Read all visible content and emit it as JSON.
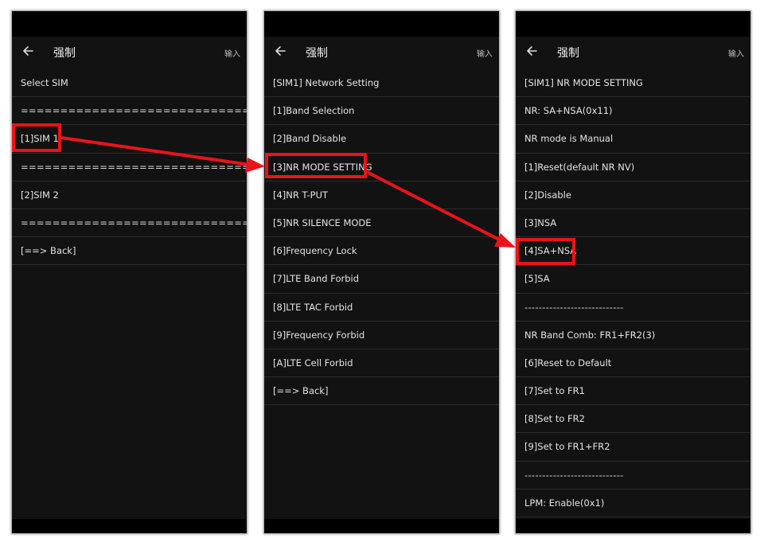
{
  "panels": [
    {
      "title": "强制",
      "action_label": "输入",
      "items": [
        "Select SIM",
        "=============================",
        "[1]SIM 1",
        "=============================",
        "[2]SIM 2",
        "=============================",
        "[==> Back]"
      ]
    },
    {
      "title": "强制",
      "action_label": "输入",
      "items": [
        "[SIM1] Network Setting",
        "[1]Band Selection",
        "[2]Band Disable",
        "[3]NR MODE SETTING",
        "[4]NR T-PUT",
        "[5]NR SILENCE MODE",
        "[6]Frequency Lock",
        "[7]LTE Band Forbid",
        "[8]LTE TAC Forbid",
        "[9]Frequency Forbid",
        "[A]LTE Cell Forbid",
        "[==> Back]"
      ]
    },
    {
      "title": "强制",
      "action_label": "输入",
      "items": [
        "[SIM1] NR MODE SETTING",
        "NR: SA+NSA(0x11)",
        "NR mode is Manual",
        "[1]Reset(default NR NV)",
        "[2]Disable",
        "[3]NSA",
        "[4]SA+NSA",
        "[5]SA",
        "----------------------------",
        "NR Band Comb: FR1+FR2(3)",
        "[6]Reset to Default",
        "[7]Set to FR1",
        "[8]Set to FR2",
        "[9]Set to FR1+FR2",
        "----------------------------",
        "LPM: Enable(0x1)"
      ]
    }
  ],
  "colors": {
    "highlight": "#e8141b",
    "panel_bg": "#121212",
    "text": "#e4e4e4"
  }
}
